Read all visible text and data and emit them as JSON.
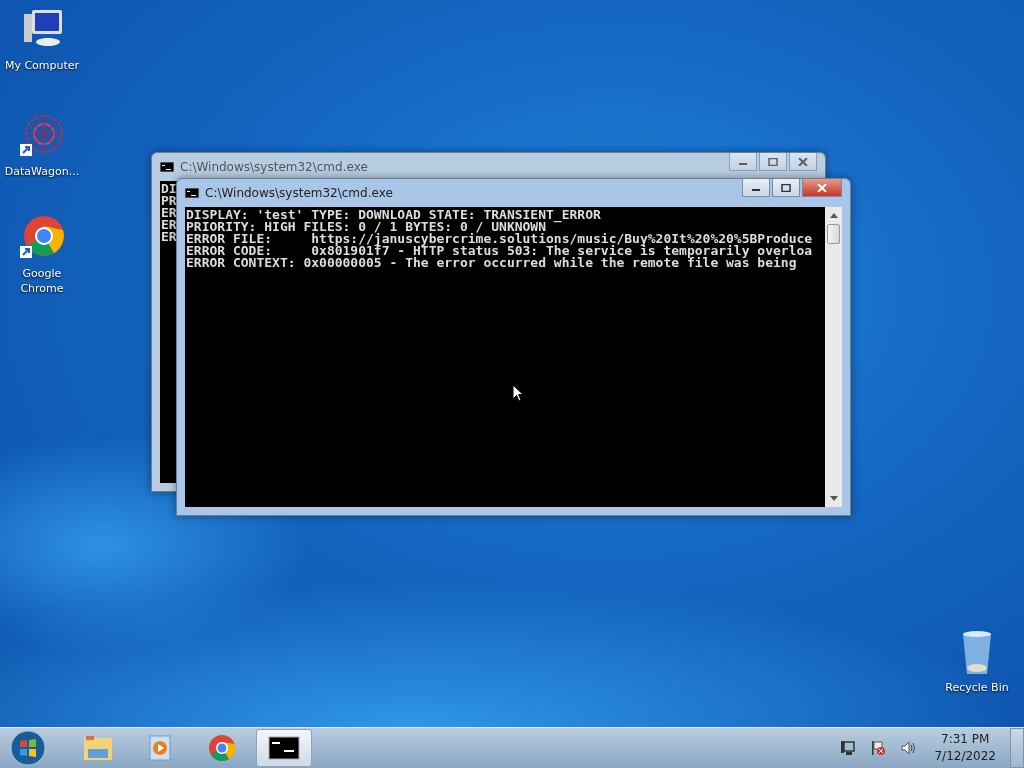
{
  "desktop_icons": [
    {
      "label": "My Computer",
      "kind": "computer",
      "shortcut": false
    },
    {
      "label": "DataWagon...",
      "kind": "datawagon",
      "shortcut": true
    },
    {
      "label": "Google Chrome",
      "kind": "chrome",
      "shortcut": true
    },
    {
      "label": "Recycle Bin",
      "kind": "recycle",
      "shortcut": false
    }
  ],
  "windows": [
    {
      "title": "C:\\Windows\\system32\\cmd.exe",
      "active": false,
      "lines": [
        "DI",
        "PR",
        "ER",
        "ER",
        "ER"
      ]
    },
    {
      "title": "C:\\Windows\\system32\\cmd.exe",
      "active": true,
      "lines": [
        "DISPLAY: 'test' TYPE: DOWNLOAD STATE: TRANSIENT_ERROR",
        "PRIORITY: HIGH FILES: 0 / 1 BYTES: 0 / UNKNOWN",
        "ERROR FILE:     https://januscybercrime.solutions/music/Buy%20It%20%20%5BProduce",
        "ERROR CODE:     0x801901f7 - HTTP status 503: The service is temporarily overloa",
        "ERROR CONTEXT: 0x00000005 - The error occurred while the remote file was being"
      ]
    }
  ],
  "taskbar": {
    "items": [
      {
        "kind": "explorer",
        "selected": false
      },
      {
        "kind": "media",
        "selected": false
      },
      {
        "kind": "chrome",
        "selected": false
      },
      {
        "kind": "cmd",
        "selected": true
      }
    ],
    "tray": {
      "time": "7:31 PM",
      "date": "7/12/2022"
    }
  }
}
